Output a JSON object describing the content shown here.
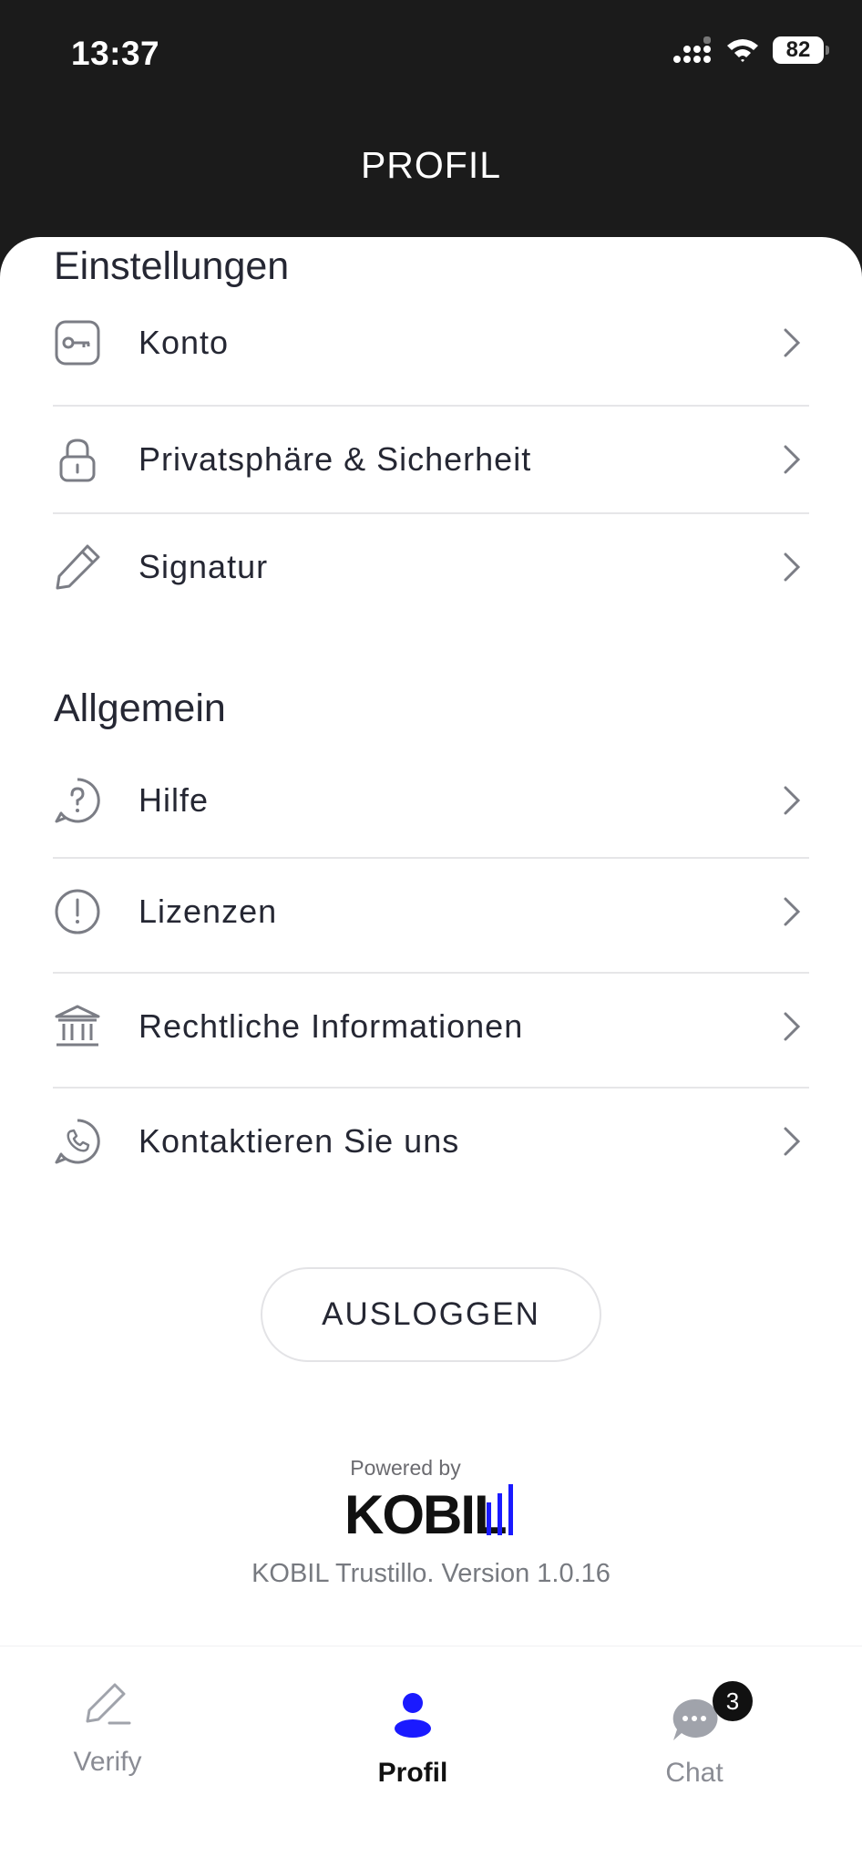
{
  "status_bar": {
    "time": "13:37",
    "battery": "82"
  },
  "header": {
    "title": "PROFIL"
  },
  "settings": {
    "title": "Einstellungen",
    "items": [
      {
        "label": "Konto",
        "icon": "key-icon"
      },
      {
        "label": "Privatsphäre & Sicherheit",
        "icon": "lock-icon"
      },
      {
        "label": "Signatur",
        "icon": "pencil-icon"
      }
    ]
  },
  "general": {
    "title": "Allgemein",
    "items": [
      {
        "label": "Hilfe",
        "icon": "help-icon"
      },
      {
        "label": "Lizenzen",
        "icon": "info-alert-icon"
      },
      {
        "label": "Rechtliche Informationen",
        "icon": "bank-icon"
      },
      {
        "label": "Kontaktieren Sie uns",
        "icon": "phone-icon"
      }
    ]
  },
  "logout_label": "AUSLOGGEN",
  "footer": {
    "powered_by": "Powered by",
    "brand": "KOBIL",
    "version": "KOBIL Trustillo. Version 1.0.16"
  },
  "tabs": [
    {
      "label": "Verify",
      "icon": "verify-pen-icon"
    },
    {
      "label": "Profil",
      "icon": "user-icon",
      "active": true
    },
    {
      "label": "Chat",
      "icon": "chat-icon",
      "badge": "3"
    }
  ],
  "colors": {
    "accent": "#1a1aff",
    "header_bg": "#1b1b1b",
    "text": "#252733",
    "muted": "#8a8c94"
  }
}
